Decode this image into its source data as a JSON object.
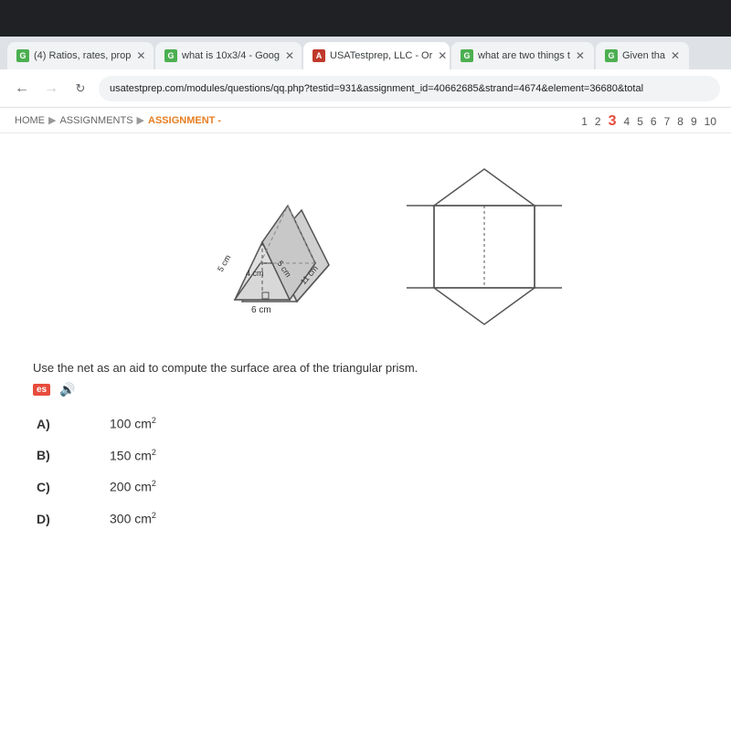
{
  "window": {
    "top_bg": "#202124"
  },
  "tabs": [
    {
      "label": "(4) Ratios, rates, prop",
      "active": false,
      "favicon_color": "#4caf50",
      "favicon_text": "G"
    },
    {
      "label": "what is 10x3/4 - Goog",
      "active": false,
      "favicon_color": "#4caf50",
      "favicon_text": "G"
    },
    {
      "label": "USATestprep, LLC - Or",
      "active": true,
      "favicon_color": "#c0392b",
      "favicon_text": "A"
    },
    {
      "label": "what are two things t",
      "active": false,
      "favicon_color": "#4caf50",
      "favicon_text": "G"
    },
    {
      "label": "Given tha",
      "active": false,
      "favicon_color": "#4caf50",
      "favicon_text": "G"
    }
  ],
  "address_bar": {
    "url": "usatestprep.com/modules/questions/qq.php?testid=931&assignment_id=40662685&strand=4674&element=36680&total"
  },
  "breadcrumb": {
    "home": "HOME",
    "assignments": "ASSIGNMENTS",
    "current": "ASSIGNMENT -"
  },
  "question_nav": {
    "numbers": [
      "1",
      "2",
      "3",
      "4",
      "5",
      "6",
      "7",
      "8",
      "9",
      "10"
    ],
    "active": 2
  },
  "figure": {
    "dimensions": {
      "side1": "5 cm",
      "side2": "5 cm",
      "height": "4 cm",
      "base": "6 cm",
      "length": "11 cm"
    }
  },
  "question": {
    "text": "Use the net as an aid to compute the surface area of the triangular prism.",
    "lang_badge": "es",
    "audio_symbol": "🔊"
  },
  "choices": [
    {
      "label": "A)",
      "text": "100 cm",
      "sup": "2"
    },
    {
      "label": "B)",
      "text": "150 cm",
      "sup": "2"
    },
    {
      "label": "C)",
      "text": "200 cm",
      "sup": "2"
    },
    {
      "label": "D)",
      "text": "300 cm",
      "sup": "2"
    }
  ]
}
